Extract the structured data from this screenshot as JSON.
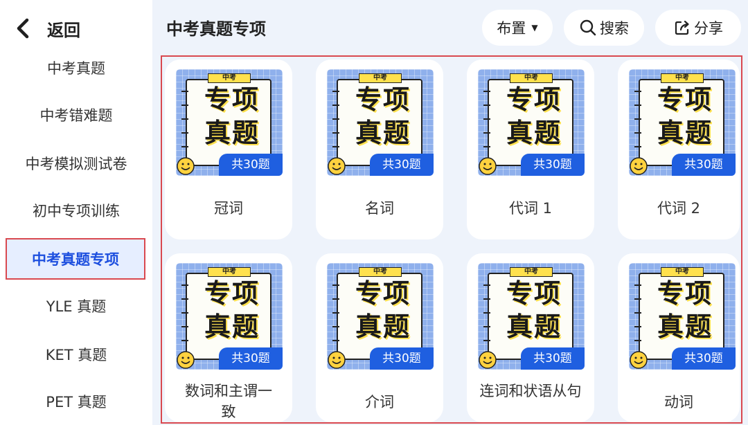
{
  "sidebar": {
    "back_label": "返回",
    "items": [
      {
        "label": "中考真题",
        "active": false
      },
      {
        "label": "中考错难题",
        "active": false
      },
      {
        "label": "中考模拟测试卷",
        "active": false
      },
      {
        "label": "初中专项训练",
        "active": false
      },
      {
        "label": "中考真题专项",
        "active": true
      },
      {
        "label": "YLE 真题",
        "active": false
      },
      {
        "label": "KET 真题",
        "active": false
      },
      {
        "label": "PET 真题",
        "active": false
      }
    ]
  },
  "header": {
    "title": "中考真题专项",
    "arrange_label": "布置",
    "search_label": "搜索",
    "share_label": "分享"
  },
  "colors": {
    "accent": "#1f5fe0",
    "highlight_border": "#d9484f",
    "cover_bg": "#8fb0ec",
    "cover_yellow": "#ffe14d"
  },
  "cover": {
    "tag": "中考",
    "line1": "专项",
    "line2": "真题",
    "count": "共30题"
  },
  "cards": [
    {
      "label": "冠词"
    },
    {
      "label": "名词"
    },
    {
      "label": "代词 1"
    },
    {
      "label": "代词 2"
    },
    {
      "label": "数词和主谓一致"
    },
    {
      "label": "介词"
    },
    {
      "label": "连词和状语从句"
    },
    {
      "label": "动词"
    }
  ],
  "icons": {
    "back": "chevron-left-icon",
    "arrange": "caret-down-icon",
    "search": "search-icon",
    "share": "share-icon"
  }
}
